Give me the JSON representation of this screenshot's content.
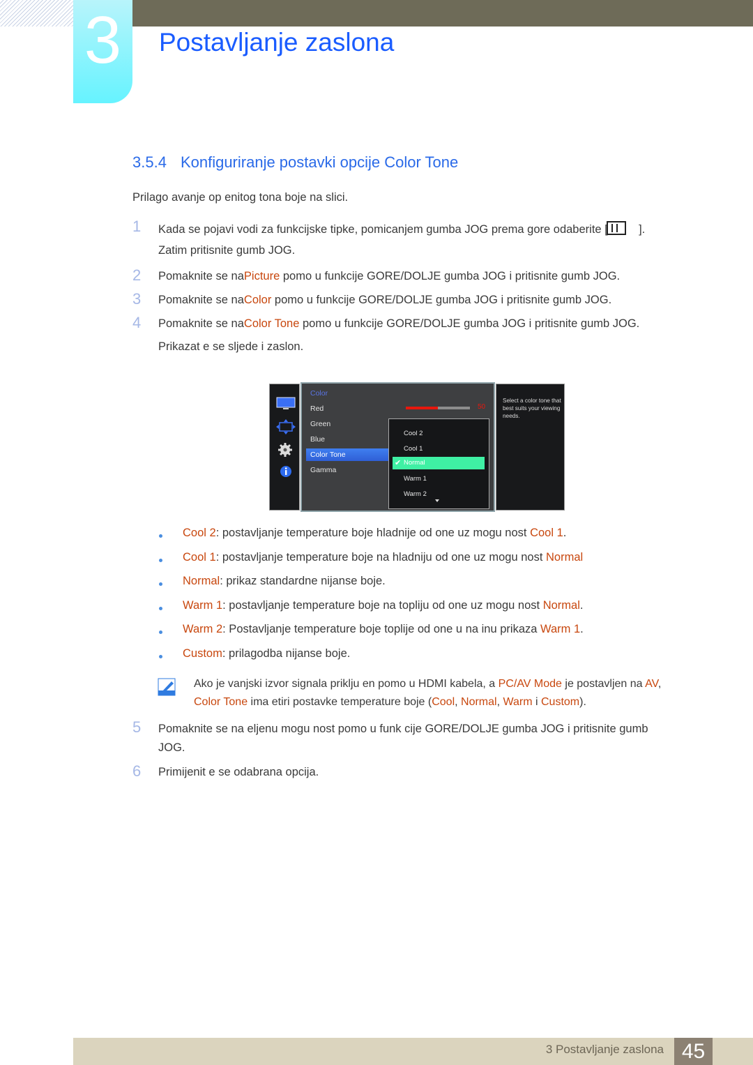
{
  "header": {
    "chapter_number": "3",
    "chapter_title": "Postavljanje zaslona"
  },
  "section": {
    "number": "3.5.4",
    "title": "Konfiguriranje postavki opcije Color Tone"
  },
  "intro": "Prilago avanje op enitog  tona boje na slici.",
  "steps": [
    {
      "num": "1",
      "line1": "Kada se pojavi vodi  za funkcijske tipke, pomicanjem gumba JOG prema gore odaberite [",
      "line1_end": "].",
      "line2": "Zatim pritisnite gumb JOG.",
      "icon": "menu-grid-icon"
    },
    {
      "num": "2",
      "pre": "Pomaknite se na",
      "hl": "Picture",
      "post": " pomo u funkcije GORE/DOLJE gumba JOG i pritisnite gumb JOG."
    },
    {
      "num": "3",
      "pre": "Pomaknite se na",
      "hl": "Color",
      "post": " pomo u funkcije GORE/DOLJE gumba JOG i pritisnite gumb JOG."
    },
    {
      "num": "4",
      "pre": "Pomaknite se na",
      "hl": "Color Tone",
      "post": " pomo u funkcije GORE/DOLJE gumba JOG i pritisnite gumb JOG.",
      "line2": "Prikazat  e se sljede i zaslon."
    },
    {
      "num": "5",
      "line1": "Pomaknite se na  eljenu mogu nost pomo u funk cije GORE/DOLJE gumba JOG i pritisnite gumb",
      "line2": "JOG."
    },
    {
      "num": "6",
      "line1": "Primijenit  e se odabrana opcija."
    }
  ],
  "osd": {
    "side_icons": [
      "monitor-icon",
      "resize-arrows-icon",
      "gear-icon",
      "info-icon"
    ],
    "menu_header": "Color",
    "menu_items": [
      "Red",
      "Green",
      "Blue",
      "Color Tone",
      "Gamma"
    ],
    "selected_menu_item": "Color Tone",
    "red_value": "50",
    "red_fraction": 0.5,
    "dropdown_options": [
      "Cool 2",
      "Cool 1",
      "Normal",
      "Warm 1",
      "Warm 2"
    ],
    "selected_option": "Normal",
    "help_text": "Select a color tone that best suits your viewing needs.",
    "colors": {
      "accent_blue": "#3f7ff0",
      "selected_green": "#3ff0a4",
      "bar_red": "#e8170d"
    }
  },
  "options": [
    {
      "name": "Cool 2",
      "desc": ": postavljanje temperature boje hladnije od one uz mogu nost ",
      "ref": "Cool 1",
      "end": "."
    },
    {
      "name": "Cool 1",
      "desc": ": postavljanje temperature boje na hladniju od one uz mogu nost ",
      "ref": "Normal",
      "end": ""
    },
    {
      "name": "Normal",
      "desc": ": prikaz standardne nijanse boje.",
      "ref": "",
      "end": ""
    },
    {
      "name": "Warm 1",
      "desc": ": postavljanje temperature boje na topliju od one uz mogu nost ",
      "ref": "Normal",
      "end": "."
    },
    {
      "name": "Warm 2",
      "desc": ": Postavljanje temperature boje toplije od one u na inu prikaza ",
      "ref": "Warm 1",
      "end": "."
    },
    {
      "name": "Custom",
      "desc": ": prilagodba nijanse boje.",
      "ref": "",
      "end": ""
    }
  ],
  "note": {
    "p1": "Ako je vanjski izvor signala priklju en pomo u HDMI kabela, a ",
    "h1": "PC/AV Mode",
    "p2": " je postavljen na ",
    "h2": "AV",
    "p3": ",",
    "h3": "Color Tone",
    "p4": " ima  etiri postavke temperature boje (",
    "h4": "Cool",
    "p5": ", ",
    "h5": "Normal",
    "p6": ", ",
    "h6": "Warm",
    "p7": " i ",
    "h7": "Custom",
    "p8": ")."
  },
  "footer": {
    "chapter_label": "3 Postavljanje zaslona",
    "page_number": "45"
  },
  "colors": {
    "title_blue": "#1a5cff",
    "highlight_orange": "#c8470e",
    "topbar": "#6e6b58",
    "footer_bg": "#dbd4be"
  }
}
